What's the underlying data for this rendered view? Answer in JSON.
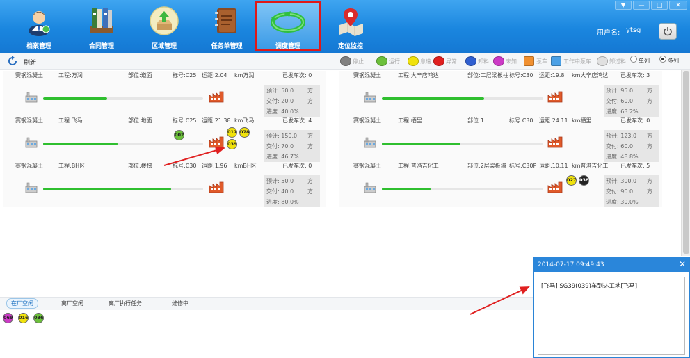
{
  "window": {
    "minimize_glyph": "▼",
    "restore_glyph": "—",
    "maximize_glyph": "□",
    "close_glyph": "✕"
  },
  "nav": [
    {
      "label": "档案管理",
      "icon": "user-avatar-icon"
    },
    {
      "label": "合同管理",
      "icon": "binders-icon"
    },
    {
      "label": "区域管理",
      "icon": "upload-box-icon"
    },
    {
      "label": "任务单管理",
      "icon": "notebook-icon"
    },
    {
      "label": "调度管理",
      "icon": "refresh-arrow-icon",
      "active": true
    },
    {
      "label": "定位监控",
      "icon": "map-pin-icon"
    }
  ],
  "user": {
    "label": "用户名:",
    "name": "ytsg"
  },
  "toolbar": {
    "refresh_label": "刷新",
    "legend": [
      {
        "label": "停止",
        "color": "#808080",
        "shape": "circle"
      },
      {
        "label": "运行",
        "color": "#6cc03b",
        "shape": "circle"
      },
      {
        "label": "怠速",
        "color": "#f0e20c",
        "shape": "circle"
      },
      {
        "label": "异常",
        "color": "#e02020",
        "shape": "circle"
      },
      {
        "label": "卸料",
        "color": "#2f5fd0",
        "shape": "circle"
      },
      {
        "label": "未知",
        "color": "#cc3ac6",
        "shape": "circle"
      },
      {
        "label": "泵车",
        "color": "#f09030",
        "shape": "square"
      },
      {
        "label": "工作中泵车",
        "color": "#4aa0e6",
        "shape": "square"
      },
      {
        "label": "卸过料",
        "color": "#e0e0e0",
        "shape": "circle"
      }
    ],
    "view_single": "单列",
    "view_multi": "多列",
    "view_selected": "多列"
  },
  "columns": [
    {
      "tasks": [
        {
          "company": "赛钢混凝土",
          "project": "工程:万润",
          "part": "部位:道面",
          "grade": "标号:C25",
          "distance": "运距:2.04",
          "unit_site": "km万润",
          "trips": "已发车次: 0",
          "progress": 0.4,
          "stats": {
            "planned": "预计: 50.0",
            "delivered": "交付: 20.0",
            "progress_text": "进度: 40.0%",
            "unit": "方"
          },
          "trucks_top": [],
          "trucks_site": []
        },
        {
          "company": "赛钢混凝土",
          "project": "工程:飞马",
          "part": "部位:地面",
          "grade": "标号:C25",
          "distance": "运距:21.38",
          "unit_site": "km飞马",
          "trips": "已发车次: 4",
          "progress": 0.467,
          "stats": {
            "planned": "预计: 150.0",
            "delivered": "交付: 70.0",
            "progress_text": "进度: 46.7%",
            "unit": "方"
          },
          "trucks_top": [
            {
              "id": "002",
              "color": "green"
            }
          ],
          "trucks_site": [
            {
              "id": "017",
              "color": "yellow"
            },
            {
              "id": "078",
              "color": "yellow"
            },
            {
              "id": "039",
              "color": "yellow"
            }
          ]
        },
        {
          "company": "赛钢混凝土",
          "project": "工程:BH区",
          "part": "部位:楼梯",
          "grade": "标号:C30",
          "distance": "运距:1.96",
          "unit_site": "kmBH区",
          "trips": "已发车次: 0",
          "progress": 0.8,
          "stats": {
            "planned": "预计: 50.0",
            "delivered": "交付: 40.0",
            "progress_text": "进度: 80.0%",
            "unit": "方"
          },
          "trucks_top": [],
          "trucks_site": []
        }
      ]
    },
    {
      "tasks": [
        {
          "company": "赛钢混凝土",
          "project": "工程:大辛店鸿达",
          "part": "部位:二层梁板柱",
          "grade": "标号:C30",
          "distance": "运距:19.8",
          "unit_site": "km大辛店鸿达",
          "trips": "已发车次: 3",
          "progress": 0.632,
          "stats": {
            "planned": "预计: 95.0",
            "delivered": "交付: 60.0",
            "progress_text": "进度: 63.2%",
            "unit": "方"
          },
          "trucks_top": [],
          "trucks_site": []
        },
        {
          "company": "赛钢混凝土",
          "project": "工程:栖里",
          "part": "部位:1",
          "grade": "标号:C30",
          "distance": "运距:24.11",
          "unit_site": "km栖里",
          "trips": "已发车次: 0",
          "progress": 0.488,
          "stats": {
            "planned": "预计: 123.0",
            "delivered": "交付: 60.0",
            "progress_text": "进度: 48.8%",
            "unit": "方"
          },
          "trucks_top": [],
          "trucks_site": []
        },
        {
          "company": "赛钢混凝土",
          "project": "工程:普洛吉化工",
          "part": "部位:2层梁板墙",
          "grade": "标号:C30P",
          "distance": "运距:10.11",
          "unit_site": "km普洛吉化工",
          "trips": "已发车次: 5",
          "progress": 0.3,
          "stats": {
            "planned": "预计: 300.0",
            "delivered": "交付: 90.0",
            "progress_text": "进度: 30.0%",
            "unit": "方"
          },
          "trucks_top": [],
          "trucks_site": [
            {
              "id": "027",
              "color": "yellow"
            },
            {
              "id": "038",
              "color": "black"
            }
          ]
        }
      ]
    }
  ],
  "bottom_tabs": [
    {
      "label": "在厂空闲",
      "active": true
    },
    {
      "label": "离厂空闲"
    },
    {
      "label": "离厂执行任务"
    },
    {
      "label": "维修中"
    }
  ],
  "idle_trucks": [
    {
      "id": "069",
      "color": "purple"
    },
    {
      "id": "016",
      "color": "yellow"
    },
    {
      "id": "036",
      "color": "green"
    }
  ],
  "notification": {
    "time": "2014-07-17 09:49:43",
    "close_glyph": "✕",
    "message": "[飞马] SG39(039)车到达工地[飞马]"
  },
  "colors": {
    "accent": "#1a86df",
    "progress": "#2fbf2f",
    "highlight": "#e01818"
  }
}
